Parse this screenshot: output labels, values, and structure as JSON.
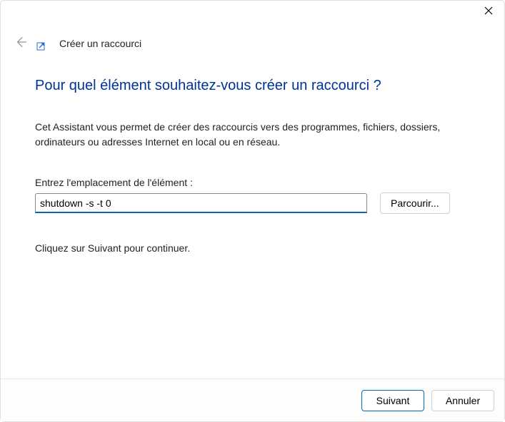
{
  "titlebar": {
    "close_label": "Close"
  },
  "header": {
    "title": "Créer un raccourci"
  },
  "content": {
    "heading": "Pour quel élément souhaitez-vous créer un raccourci ?",
    "description": "Cet Assistant vous permet de créer des raccourcis vers des programmes, fichiers, dossiers, ordinateurs ou adresses Internet en local ou en réseau.",
    "input_label": "Entrez l'emplacement de l'élément :",
    "input_value": "shutdown -s -t 0",
    "browse_label": "Parcourir...",
    "continue_text": "Cliquez sur Suivant pour continuer."
  },
  "footer": {
    "next_label": "Suivant",
    "cancel_label": "Annuler"
  }
}
